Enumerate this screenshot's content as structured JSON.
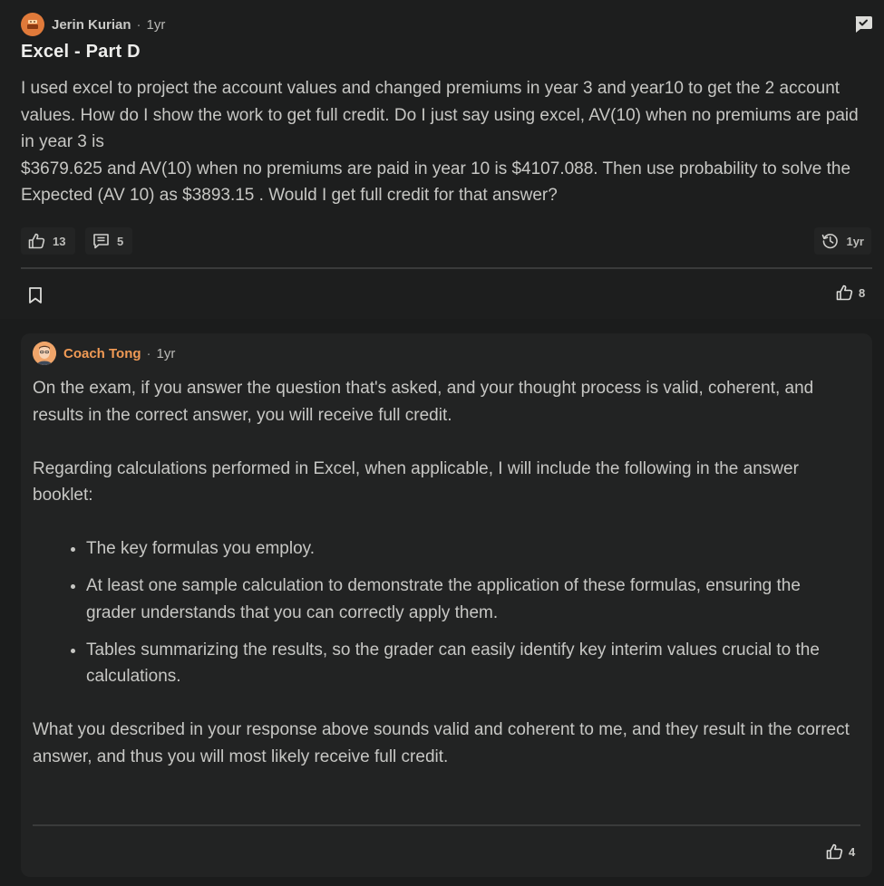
{
  "post": {
    "author": "Jerin Kurian",
    "age": "1yr",
    "title": "Excel - Part D",
    "body": [
      "I used excel to project the account values and changed premiums in year 3 and year10 to get the 2 account values. How do I show the work to get full credit. Do I just say using excel, AV(10) when no premiums are paid in year 3 is",
      "$3679.625 and AV(10) when no premiums are paid in year 10 is $4107.088. Then use probability to solve the Expected (AV 10) as $3893.15 . Would I get full credit for that answer?"
    ],
    "likes": "13",
    "comments": "5",
    "history_age": "1yr",
    "votes": "8",
    "icons": {
      "avatar": "avatar-icon",
      "chat": "chat-check-icon",
      "like": "thumbs-up-icon",
      "comment": "comment-icon",
      "history": "history-icon",
      "bookmark": "bookmark-icon"
    }
  },
  "answer": {
    "author": "Coach Tong",
    "age": "1yr",
    "para1": "On the exam, if you answer the question that's asked, and your thought process is valid, coherent, and results in the correct answer, you will receive full credit.",
    "para2": "Regarding calculations performed in Excel, when applicable, I will include the following in the answer booklet:",
    "bullets": [
      "The key formulas you employ.",
      "At least one sample calculation to demonstrate the application of these formulas, ensuring the grader understands that you can correctly apply them.",
      "Tables summarizing the results, so the grader can easily identify key interim values crucial to the calculations."
    ],
    "para3": "What you described in your response above sounds valid and coherent to me, and they result in the correct answer, and thus you will most likely receive full credit.",
    "votes": "4"
  },
  "colors": {
    "background": "#1b1c1c",
    "card": "#222323",
    "coach_accent": "#f09a55",
    "avatar_orange": "#e07a3a"
  }
}
